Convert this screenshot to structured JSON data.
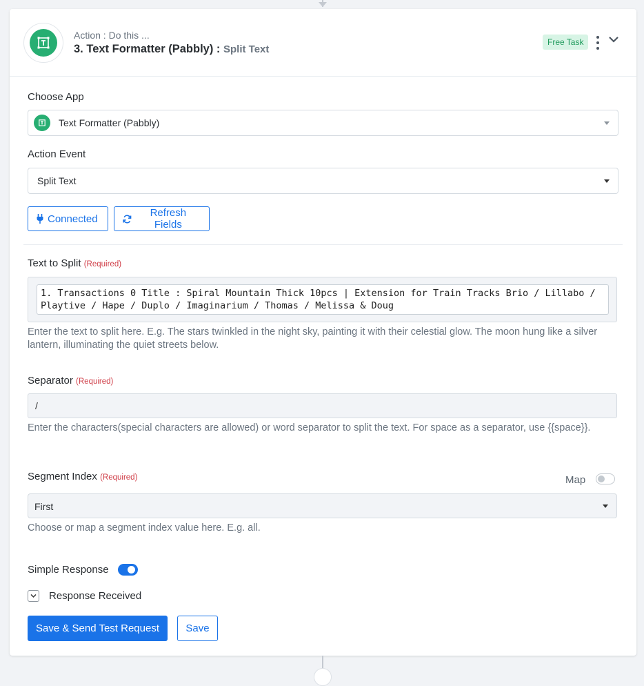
{
  "header": {
    "subtitle": "Action : Do this ...",
    "title": "3. Text Formatter (Pabbly) :",
    "action_name": "Split Text",
    "badge": "Free Task",
    "icons": {
      "logo": "text-formatter-icon",
      "menu": "kebab-icon",
      "collapse": "chevron-down-icon"
    }
  },
  "choose_app": {
    "label": "Choose App",
    "value": "Text Formatter (Pabbly)"
  },
  "action_event": {
    "label": "Action Event",
    "value": "Split Text"
  },
  "buttons": {
    "connected": "Connected",
    "refresh": "Refresh Fields",
    "save_send": "Save & Send Test Request",
    "save": "Save"
  },
  "text_to_split": {
    "label": "Text to Split",
    "required": "(Required)",
    "value": "1. Transactions 0 Title : Spiral Mountain Thick 10pcs | Extension for Train Tracks Brio / Lillabo / Playtive / Hape / Duplo / Imaginarium / Thomas / Melissa & Doug",
    "help": "Enter the text to split here. E.g. The stars twinkled in the night sky, painting it with their celestial glow. The moon hung like a silver lantern, illuminating the quiet streets below."
  },
  "separator": {
    "label": "Separator",
    "required": "(Required)",
    "value": "/",
    "help": "Enter the characters(special characters are allowed) or word separator to split the text. For space as a separator, use {{space}}."
  },
  "segment_index": {
    "label": "Segment Index",
    "required": "(Required)",
    "map_label": "Map",
    "map_enabled": false,
    "value": "First",
    "help": "Choose or map a segment index value here. E.g. all."
  },
  "simple_response": {
    "label": "Simple Response",
    "enabled": true
  },
  "response_received": {
    "label": "Response Received"
  },
  "colors": {
    "accent": "#1a73e8",
    "brand_green": "#27ae72",
    "required": "#d0404a",
    "badge_bg": "#d7f4e5",
    "badge_text": "#1f9a5c"
  }
}
